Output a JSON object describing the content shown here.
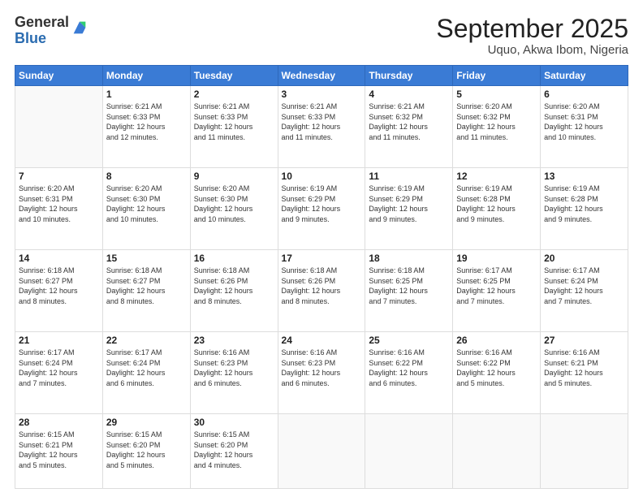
{
  "logo": {
    "general": "General",
    "blue": "Blue"
  },
  "header": {
    "month": "September 2025",
    "location": "Uquo, Akwa Ibom, Nigeria"
  },
  "weekdays": [
    "Sunday",
    "Monday",
    "Tuesday",
    "Wednesday",
    "Thursday",
    "Friday",
    "Saturday"
  ],
  "weeks": [
    [
      {
        "day": "",
        "info": ""
      },
      {
        "day": "1",
        "info": "Sunrise: 6:21 AM\nSunset: 6:33 PM\nDaylight: 12 hours\nand 12 minutes."
      },
      {
        "day": "2",
        "info": "Sunrise: 6:21 AM\nSunset: 6:33 PM\nDaylight: 12 hours\nand 11 minutes."
      },
      {
        "day": "3",
        "info": "Sunrise: 6:21 AM\nSunset: 6:33 PM\nDaylight: 12 hours\nand 11 minutes."
      },
      {
        "day": "4",
        "info": "Sunrise: 6:21 AM\nSunset: 6:32 PM\nDaylight: 12 hours\nand 11 minutes."
      },
      {
        "day": "5",
        "info": "Sunrise: 6:20 AM\nSunset: 6:32 PM\nDaylight: 12 hours\nand 11 minutes."
      },
      {
        "day": "6",
        "info": "Sunrise: 6:20 AM\nSunset: 6:31 PM\nDaylight: 12 hours\nand 10 minutes."
      }
    ],
    [
      {
        "day": "7",
        "info": "Sunrise: 6:20 AM\nSunset: 6:31 PM\nDaylight: 12 hours\nand 10 minutes."
      },
      {
        "day": "8",
        "info": "Sunrise: 6:20 AM\nSunset: 6:30 PM\nDaylight: 12 hours\nand 10 minutes."
      },
      {
        "day": "9",
        "info": "Sunrise: 6:20 AM\nSunset: 6:30 PM\nDaylight: 12 hours\nand 10 minutes."
      },
      {
        "day": "10",
        "info": "Sunrise: 6:19 AM\nSunset: 6:29 PM\nDaylight: 12 hours\nand 9 minutes."
      },
      {
        "day": "11",
        "info": "Sunrise: 6:19 AM\nSunset: 6:29 PM\nDaylight: 12 hours\nand 9 minutes."
      },
      {
        "day": "12",
        "info": "Sunrise: 6:19 AM\nSunset: 6:28 PM\nDaylight: 12 hours\nand 9 minutes."
      },
      {
        "day": "13",
        "info": "Sunrise: 6:19 AM\nSunset: 6:28 PM\nDaylight: 12 hours\nand 9 minutes."
      }
    ],
    [
      {
        "day": "14",
        "info": "Sunrise: 6:18 AM\nSunset: 6:27 PM\nDaylight: 12 hours\nand 8 minutes."
      },
      {
        "day": "15",
        "info": "Sunrise: 6:18 AM\nSunset: 6:27 PM\nDaylight: 12 hours\nand 8 minutes."
      },
      {
        "day": "16",
        "info": "Sunrise: 6:18 AM\nSunset: 6:26 PM\nDaylight: 12 hours\nand 8 minutes."
      },
      {
        "day": "17",
        "info": "Sunrise: 6:18 AM\nSunset: 6:26 PM\nDaylight: 12 hours\nand 8 minutes."
      },
      {
        "day": "18",
        "info": "Sunrise: 6:18 AM\nSunset: 6:25 PM\nDaylight: 12 hours\nand 7 minutes."
      },
      {
        "day": "19",
        "info": "Sunrise: 6:17 AM\nSunset: 6:25 PM\nDaylight: 12 hours\nand 7 minutes."
      },
      {
        "day": "20",
        "info": "Sunrise: 6:17 AM\nSunset: 6:24 PM\nDaylight: 12 hours\nand 7 minutes."
      }
    ],
    [
      {
        "day": "21",
        "info": "Sunrise: 6:17 AM\nSunset: 6:24 PM\nDaylight: 12 hours\nand 7 minutes."
      },
      {
        "day": "22",
        "info": "Sunrise: 6:17 AM\nSunset: 6:24 PM\nDaylight: 12 hours\nand 6 minutes."
      },
      {
        "day": "23",
        "info": "Sunrise: 6:16 AM\nSunset: 6:23 PM\nDaylight: 12 hours\nand 6 minutes."
      },
      {
        "day": "24",
        "info": "Sunrise: 6:16 AM\nSunset: 6:23 PM\nDaylight: 12 hours\nand 6 minutes."
      },
      {
        "day": "25",
        "info": "Sunrise: 6:16 AM\nSunset: 6:22 PM\nDaylight: 12 hours\nand 6 minutes."
      },
      {
        "day": "26",
        "info": "Sunrise: 6:16 AM\nSunset: 6:22 PM\nDaylight: 12 hours\nand 5 minutes."
      },
      {
        "day": "27",
        "info": "Sunrise: 6:16 AM\nSunset: 6:21 PM\nDaylight: 12 hours\nand 5 minutes."
      }
    ],
    [
      {
        "day": "28",
        "info": "Sunrise: 6:15 AM\nSunset: 6:21 PM\nDaylight: 12 hours\nand 5 minutes."
      },
      {
        "day": "29",
        "info": "Sunrise: 6:15 AM\nSunset: 6:20 PM\nDaylight: 12 hours\nand 5 minutes."
      },
      {
        "day": "30",
        "info": "Sunrise: 6:15 AM\nSunset: 6:20 PM\nDaylight: 12 hours\nand 4 minutes."
      },
      {
        "day": "",
        "info": ""
      },
      {
        "day": "",
        "info": ""
      },
      {
        "day": "",
        "info": ""
      },
      {
        "day": "",
        "info": ""
      }
    ]
  ]
}
